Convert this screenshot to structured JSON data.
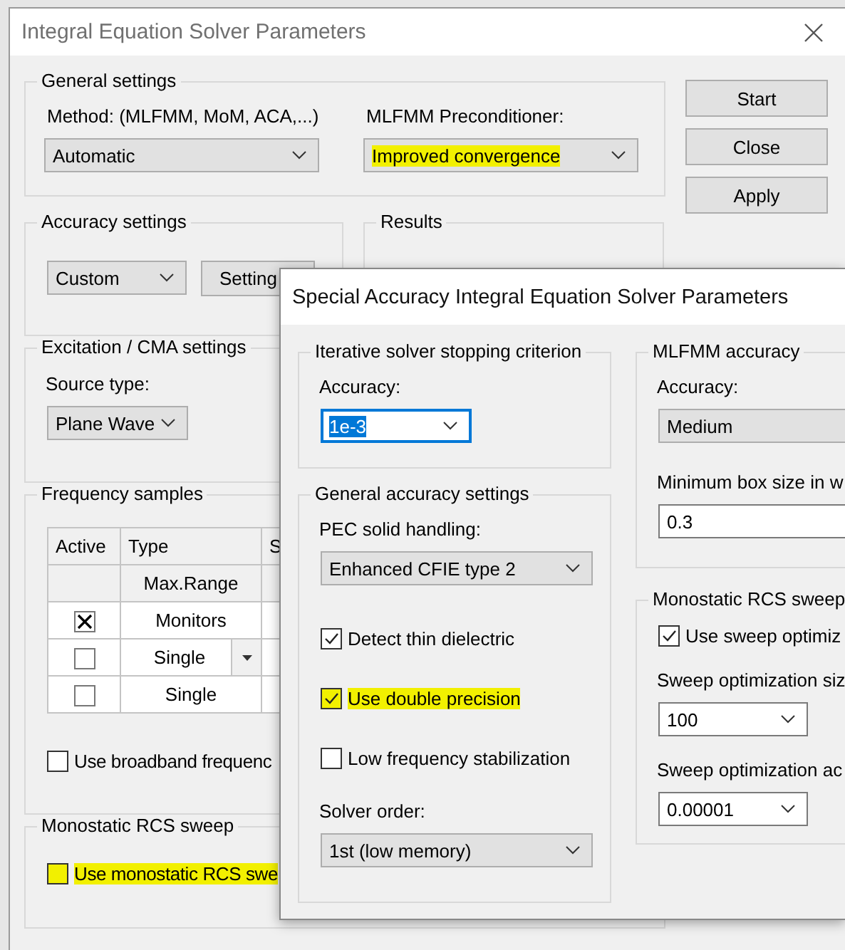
{
  "main_dialog": {
    "title": "Integral Equation Solver Parameters",
    "general_settings": {
      "title": "General settings",
      "fields": [
        {
          "label": "Method: (MLFMM, MoM, ACA,...)",
          "combo": {
            "kind": "list",
            "value": "Automatic",
            "highlighted": false
          }
        },
        {
          "label": "MLFMM Preconditioner:",
          "combo": {
            "kind": "list",
            "value": "Improved convergence",
            "highlighted": true
          }
        }
      ]
    },
    "accuracy_settings": {
      "title": "Accuracy settings",
      "combo": {
        "kind": "list",
        "value": "Custom",
        "highlighted": false
      },
      "button": "Setting"
    },
    "results": {
      "title": "Results"
    },
    "excitation": {
      "title": "Excitation / CMA settings",
      "label": "Source type:",
      "combo": {
        "kind": "list",
        "value": "Plane Wave",
        "highlighted": false
      }
    },
    "frequency_samples": {
      "title": "Frequency samples",
      "columns": [
        "Active",
        "Type",
        "S"
      ],
      "rows": [
        {
          "kind": "range",
          "type": "Max.Range"
        },
        {
          "kind": "sample",
          "active": true,
          "type": "Monitors",
          "dropdown": false
        },
        {
          "kind": "sample",
          "active": false,
          "type": "Single",
          "dropdown": true
        },
        {
          "kind": "sample",
          "active": false,
          "type": "Single",
          "dropdown": false
        }
      ],
      "checkbox": {
        "label": "Use broadband frequenc",
        "checked": false
      }
    },
    "monostatic": {
      "title": "Monostatic RCS sweep",
      "checkbox": {
        "label": "Use monostatic RCS swe",
        "checked": false,
        "highlighted": true
      }
    },
    "buttons": [
      "Start",
      "Close",
      "Apply"
    ]
  },
  "special_dialog": {
    "title": "Special Accuracy Integral Equation Solver Parameters",
    "stopping_criterion": {
      "title": "Iterative solver stopping criterion",
      "label": "Accuracy:",
      "combo": {
        "kind": "editable",
        "value": "1e-3",
        "focused": true
      }
    },
    "general_accuracy": {
      "title": "General accuracy settings",
      "pec_label": "PEC solid handling:",
      "pec_combo": {
        "kind": "list",
        "value": "Enhanced CFIE type 2"
      },
      "checkboxes": [
        {
          "label": "Detect thin dielectric",
          "checked": true,
          "highlighted": false
        },
        {
          "label": "Use double precision",
          "checked": true,
          "highlighted": true
        },
        {
          "label": "Low frequency stabilization",
          "checked": false,
          "highlighted": false
        }
      ],
      "order_label": "Solver order:",
      "order_combo": {
        "kind": "list",
        "value": "1st (low memory)"
      }
    },
    "mlfmm_accuracy": {
      "title": "MLFMM accuracy",
      "label": "Accuracy:",
      "combo": {
        "kind": "list-edge",
        "value": "Medium"
      },
      "box_label": "Minimum box size in w",
      "box_field": {
        "kind": "text",
        "value": "0.3"
      }
    },
    "monostatic": {
      "title": "Monostatic RCS sweep",
      "checkbox": {
        "label": "Use sweep optimiz",
        "checked": true
      },
      "size_label": "Sweep optimization siz",
      "size_combo": {
        "kind": "editable",
        "value": "100"
      },
      "acc_label": "Sweep optimization ac",
      "acc_combo": {
        "kind": "editable",
        "value": "0.00001"
      }
    }
  }
}
